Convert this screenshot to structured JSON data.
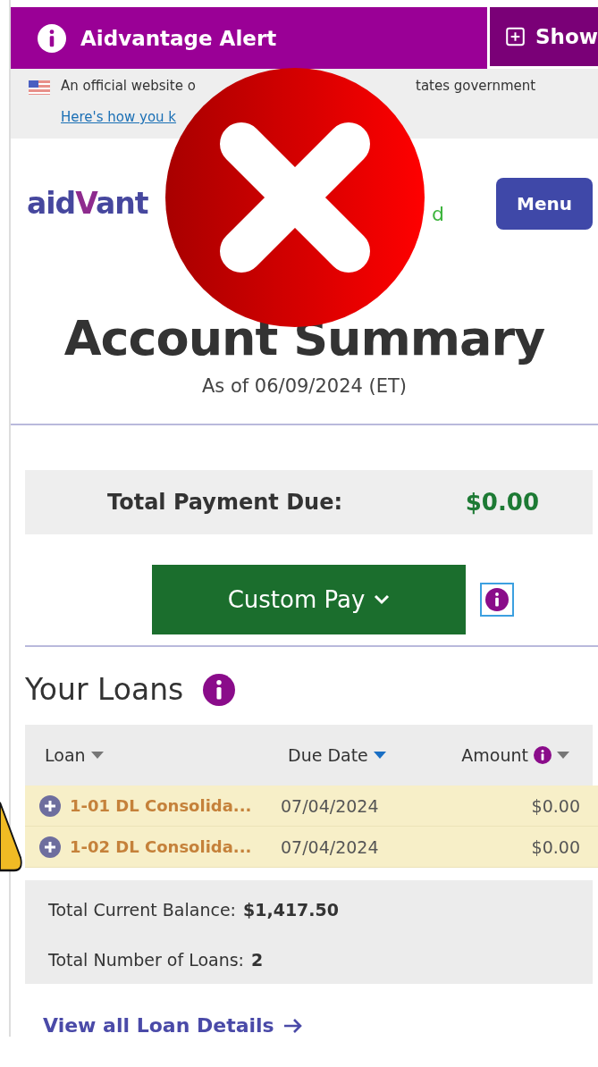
{
  "alert_bar": {
    "title": "Aidvantage Alert",
    "show_button": "Show"
  },
  "gov_banner": {
    "text_start": "An official website o",
    "text_end": "tates government",
    "link": "Here's how you k"
  },
  "header": {
    "logo": "aidVant",
    "tagline_fragment": "d",
    "menu_button": "Menu"
  },
  "page_title": "Account Summary",
  "as_of": "As of 06/09/2024 (ET)",
  "payment": {
    "label": "Total Payment Due:",
    "amount": "$0.00",
    "button": "Custom Pay"
  },
  "loans": {
    "title": "Your Loans",
    "columns": [
      {
        "label": "Loan",
        "sorted": false,
        "info": false
      },
      {
        "label": "Due Date",
        "sorted": true,
        "info": false
      },
      {
        "label": "Amount",
        "sorted": false,
        "info": true
      }
    ],
    "rows": [
      {
        "loan": "1-01 DL Consolida...",
        "due_date": "07/04/2024",
        "amount": "$0.00",
        "highlighted": true
      },
      {
        "loan": "1-02 DL Consolida...",
        "due_date": "07/04/2024",
        "amount": "$0.00",
        "highlighted": true
      }
    ],
    "totals": [
      {
        "label": "Total Current Balance:",
        "value": "$1,417.50"
      },
      {
        "label": "Total Number of Loans:",
        "value": "2"
      }
    ],
    "details_link": "View all Loan Details"
  }
}
